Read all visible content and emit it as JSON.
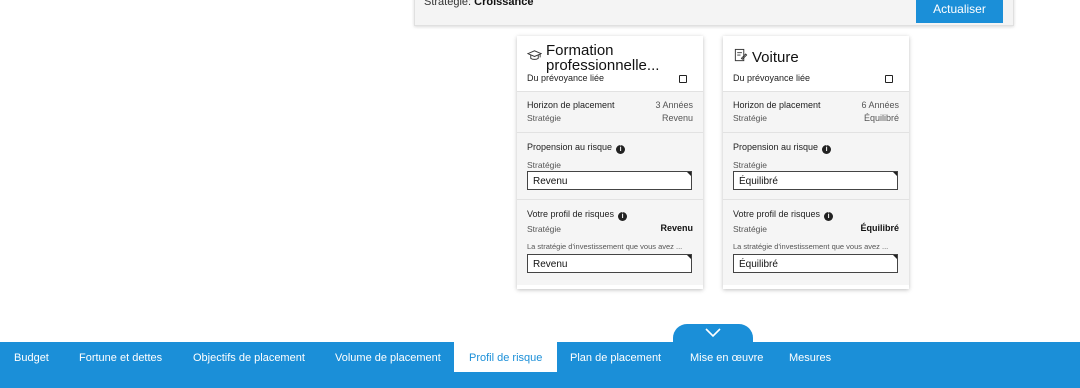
{
  "top_panel": {
    "strategy_label": "Stratégie:",
    "strategy_value": "Croissance",
    "update_button": "Actualiser"
  },
  "cards": [
    {
      "icon": "graduation-cap-icon",
      "title_line1": "Formation",
      "title_line2": "professionnelle...",
      "linked_label": "Du prévoyance liée",
      "horizon_label": "Horizon de placement",
      "horizon_value": "3 Années",
      "strategy_label": "Stratégie",
      "strategy_value": "Revenu",
      "propensity_label": "Propension au risque",
      "propensity_sub": "Stratégie",
      "propensity_field": "Revenu",
      "profile_label": "Votre profil de risques",
      "profile_sub": "Stratégie",
      "profile_value": "Revenu",
      "profile_note": "La stratégie d'investissement que vous avez ...",
      "profile_field": "Revenu"
    },
    {
      "icon": "car-document-icon",
      "title_line1": "Voiture",
      "title_line2": "",
      "linked_label": "Du prévoyance liée",
      "horizon_label": "Horizon de placement",
      "horizon_value": "6 Années",
      "strategy_label": "Stratégie",
      "strategy_value": "Équilibré",
      "propensity_label": "Propension au risque",
      "propensity_sub": "Stratégie",
      "propensity_field": "Équilibré",
      "profile_label": "Votre profil de risques",
      "profile_sub": "Stratégie",
      "profile_value": "Équilibré",
      "profile_note": "La stratégie d'investissement que vous avez ...",
      "profile_field": "Équilibré"
    }
  ],
  "info_glyph": "i",
  "nav": {
    "items": [
      {
        "label": "Budget"
      },
      {
        "label": "Fortune et dettes"
      },
      {
        "label": "Objectifs de placement"
      },
      {
        "label": "Volume de placement"
      },
      {
        "label": "Profil de risque"
      },
      {
        "label": "Plan de placement"
      },
      {
        "label": "Mise en œuvre"
      },
      {
        "label": "Mesures"
      }
    ],
    "active_index": 4
  },
  "colors": {
    "accent": "#1b8fd8",
    "panel_bg": "#f5f5f5"
  }
}
